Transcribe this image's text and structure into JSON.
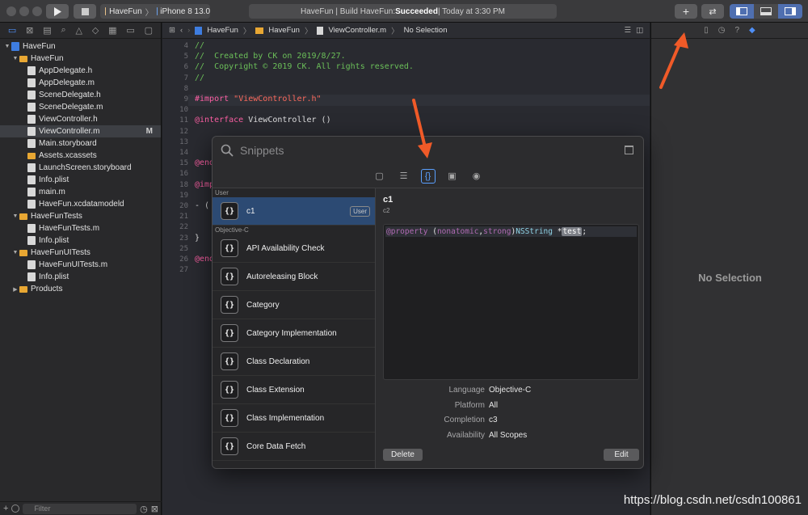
{
  "toolbar": {
    "scheme_target": "HaveFun",
    "scheme_device": "iPhone 8 13.0",
    "activity_prefix": "HaveFun | Build HaveFun: ",
    "activity_status": "Succeeded",
    "activity_time": " | Today at 3:30 PM"
  },
  "navigator": {
    "items": [
      {
        "label": "HaveFun",
        "kind": "project",
        "level": 0,
        "open": true
      },
      {
        "label": "HaveFun",
        "kind": "folder",
        "level": 1,
        "open": true
      },
      {
        "label": "AppDelegate.h",
        "kind": "file",
        "level": 2
      },
      {
        "label": "AppDelegate.m",
        "kind": "file",
        "level": 2
      },
      {
        "label": "SceneDelegate.h",
        "kind": "file",
        "level": 2
      },
      {
        "label": "SceneDelegate.m",
        "kind": "file",
        "level": 2
      },
      {
        "label": "ViewController.h",
        "kind": "file",
        "level": 2
      },
      {
        "label": "ViewController.m",
        "kind": "file",
        "level": 2,
        "selected": true,
        "badge": "M"
      },
      {
        "label": "Main.storyboard",
        "kind": "file",
        "level": 2
      },
      {
        "label": "Assets.xcassets",
        "kind": "folder",
        "level": 2
      },
      {
        "label": "LaunchScreen.storyboard",
        "kind": "file",
        "level": 2
      },
      {
        "label": "Info.plist",
        "kind": "file",
        "level": 2
      },
      {
        "label": "main.m",
        "kind": "file",
        "level": 2
      },
      {
        "label": "HaveFun.xcdatamodeld",
        "kind": "file",
        "level": 2
      },
      {
        "label": "HaveFunTests",
        "kind": "folder",
        "level": 1,
        "open": true
      },
      {
        "label": "HaveFunTests.m",
        "kind": "file",
        "level": 2
      },
      {
        "label": "Info.plist",
        "kind": "file",
        "level": 2
      },
      {
        "label": "HaveFunUITests",
        "kind": "folder",
        "level": 1,
        "open": true
      },
      {
        "label": "HaveFunUITests.m",
        "kind": "file",
        "level": 2
      },
      {
        "label": "Info.plist",
        "kind": "file",
        "level": 2
      },
      {
        "label": "Products",
        "kind": "folder",
        "level": 1,
        "open": false
      }
    ],
    "filter_placeholder": "Filter"
  },
  "jumpbar": {
    "crumbs": [
      "HaveFun",
      "HaveFun",
      "ViewController.m",
      "No Selection"
    ]
  },
  "editor": {
    "lines": [
      {
        "n": "4",
        "parts": [
          {
            "t": "//",
            "c": "cmt"
          }
        ]
      },
      {
        "n": "5",
        "parts": [
          {
            "t": "//  Created by CK on 2019/8/27.",
            "c": "cmt"
          }
        ]
      },
      {
        "n": "6",
        "parts": [
          {
            "t": "//  Copyright © 2019 CK. All rights reserved.",
            "c": "cmt"
          }
        ]
      },
      {
        "n": "7",
        "parts": [
          {
            "t": "//",
            "c": "cmt"
          }
        ]
      },
      {
        "n": "8",
        "parts": []
      },
      {
        "n": "9",
        "parts": [
          {
            "t": "#import ",
            "c": "kw"
          },
          {
            "t": "\"ViewController.h\"",
            "c": "str"
          }
        ],
        "highlight": true
      },
      {
        "n": "10",
        "parts": []
      },
      {
        "n": "11",
        "parts": [
          {
            "t": "@interface",
            "c": "kw"
          },
          {
            "t": " ViewController ()",
            "c": ""
          }
        ]
      },
      {
        "n": "12",
        "parts": []
      },
      {
        "n": "13",
        "parts": []
      },
      {
        "n": "14",
        "parts": []
      },
      {
        "n": "15",
        "parts": [
          {
            "t": "@end",
            "c": "kw"
          }
        ]
      },
      {
        "n": "16",
        "parts": []
      },
      {
        "n": "18",
        "parts": [
          {
            "t": "@imp",
            "c": "kw"
          }
        ]
      },
      {
        "n": "19",
        "parts": []
      },
      {
        "n": "20",
        "parts": [
          {
            "t": "- (",
            "c": ""
          }
        ]
      },
      {
        "n": "21",
        "parts": []
      },
      {
        "n": "22",
        "parts": []
      },
      {
        "n": "23",
        "parts": [
          {
            "t": "}",
            "c": ""
          }
        ]
      },
      {
        "n": "25",
        "parts": []
      },
      {
        "n": "26",
        "parts": [
          {
            "t": "@end",
            "c": "kw"
          }
        ]
      },
      {
        "n": "27",
        "parts": []
      }
    ]
  },
  "library": {
    "search_placeholder": "Snippets",
    "tabs": [
      {
        "icon": "view-icon",
        "glyph": "▢"
      },
      {
        "icon": "modifiers-icon",
        "glyph": "☰"
      },
      {
        "icon": "snippets-icon",
        "glyph": "{}",
        "selected": true
      },
      {
        "icon": "media-icon",
        "glyph": "▣"
      },
      {
        "icon": "color-icon",
        "glyph": "◉"
      }
    ],
    "group_user": "User",
    "user_items": [
      {
        "label": "c1",
        "tag": "User",
        "selected": true
      }
    ],
    "group_objc": "Objective-C",
    "objc_items": [
      {
        "label": "API Availability Check"
      },
      {
        "label": "Autoreleasing Block"
      },
      {
        "label": "Category"
      },
      {
        "label": "Category Implementation"
      },
      {
        "label": "Class Declaration"
      },
      {
        "label": "Class Extension"
      },
      {
        "label": "Class Implementation"
      },
      {
        "label": "Core Data Fetch"
      }
    ],
    "snippet_icon_glyph": "{}",
    "detail": {
      "title": "c1",
      "subtitle": "c2",
      "code": {
        "kw1": "@property",
        "paren_open": " (",
        "attr1": "nonatomic",
        "comma": ",",
        "attr2": "strong",
        "paren_close": ")",
        "type": "NSString",
        "star": " *",
        "placeholder": "test",
        "semi": ";"
      },
      "meta": [
        {
          "key": "Language",
          "value": "Objective-C"
        },
        {
          "key": "Platform",
          "value": "All"
        },
        {
          "key": "Completion",
          "value": "c3"
        },
        {
          "key": "Availability",
          "value": "All Scopes"
        }
      ],
      "delete_label": "Delete",
      "edit_label": "Edit"
    }
  },
  "inspector": {
    "empty_label": "No Selection"
  },
  "watermark": "https://blog.csdn.net/csdn100861",
  "colors": {
    "accent": "#4f8ff7",
    "annotation_arrow": "#f05a28",
    "comment": "#6bbf59",
    "keyword": "#fc5fa3",
    "string": "#fc6a5d"
  }
}
